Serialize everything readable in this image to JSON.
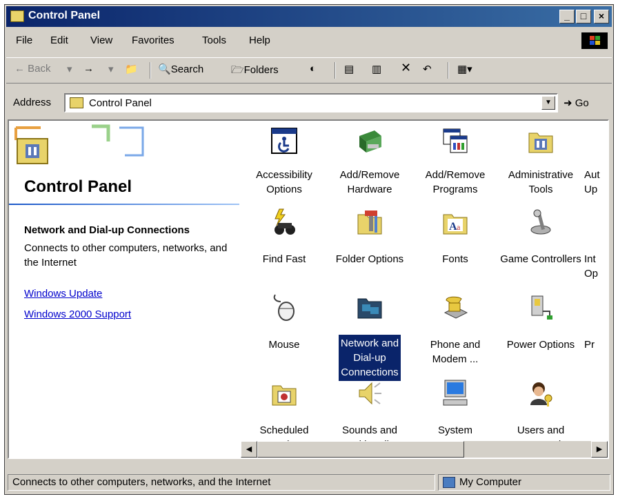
{
  "window": {
    "title": "Control Panel"
  },
  "menu": [
    "File",
    "Edit",
    "View",
    "Favorites",
    "Tools",
    "Help"
  ],
  "toolbar": {
    "back": "Back",
    "search": "Search",
    "folders": "Folders",
    "views": "Views"
  },
  "address": {
    "label": "Address",
    "value": "Control Panel",
    "go": "Go"
  },
  "left_pane": {
    "title": "Control Panel",
    "selected_title": "Network and Dial-up Connections",
    "selected_desc": "Connects to other computers, networks, and the Internet",
    "links": [
      "Windows Update",
      "Windows 2000 Support"
    ]
  },
  "items": [
    {
      "label": "Accessibility Options",
      "icon": "accessibility-icon"
    },
    {
      "label": "Add/Remove Hardware",
      "icon": "add-hardware-icon"
    },
    {
      "label": "Add/Remove Programs",
      "icon": "add-programs-icon"
    },
    {
      "label": "Administrative Tools",
      "icon": "admin-tools-icon"
    },
    {
      "label": "Aut Up",
      "icon": "automatic-updates-icon"
    },
    {
      "label": "Find Fast",
      "icon": "find-fast-icon"
    },
    {
      "label": "Folder Options",
      "icon": "folder-options-icon"
    },
    {
      "label": "Fonts",
      "icon": "fonts-icon"
    },
    {
      "label": "Game Controllers",
      "icon": "game-controllers-icon"
    },
    {
      "label": "Int Op",
      "icon": "internet-options-icon"
    },
    {
      "label": "Mouse",
      "icon": "mouse-icon"
    },
    {
      "label": "Network and Dial-up Connections",
      "icon": "network-icon"
    },
    {
      "label": "Phone and Modem ...",
      "icon": "phone-modem-icon"
    },
    {
      "label": "Power Options",
      "icon": "power-options-icon"
    },
    {
      "label": "Pr",
      "icon": "printers-icon"
    },
    {
      "label": "Scheduled Tasks",
      "icon": "scheduled-tasks-icon"
    },
    {
      "label": "Sounds and Multimedia",
      "icon": "sounds-icon"
    },
    {
      "label": "System",
      "icon": "system-icon"
    },
    {
      "label": "Users and Passwords",
      "icon": "users-icon"
    }
  ],
  "status": {
    "text": "Connects to other computers, networks, and the Internet",
    "zone": "My Computer"
  }
}
